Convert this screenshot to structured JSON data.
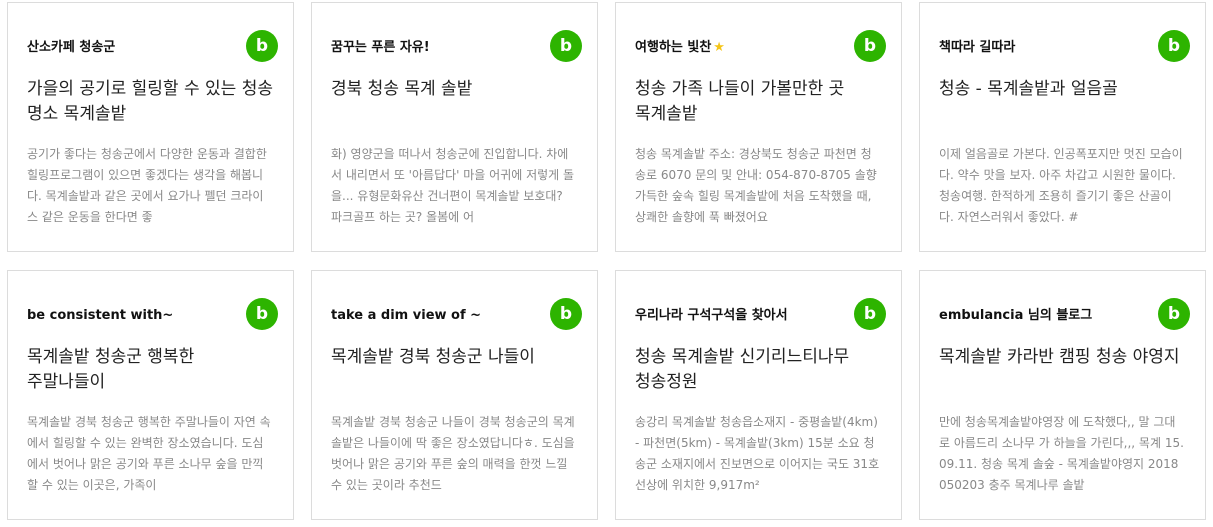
{
  "colors": {
    "brand_green": "#2db400",
    "border": "#dcdcdc",
    "title_text": "#222222",
    "snippet_text": "#888888",
    "star": "#f5c518"
  },
  "icons": {
    "blog_badge": "b",
    "star": "★"
  },
  "cards": [
    {
      "blog_name": "산소카페 청송군",
      "title": "가을의 공기로 힐링할 수 있는 청송 명소 목계솔밭",
      "snippet": "공기가 좋다는 청송군에서 다양한 운동과 결합한 힐링프로그램이 있으면 좋겠다는 생각을 해봅니다. 목계솔밭과 같은 곳에서 요가나 펠던 크라이스 같은 운동을 한다면 좋"
    },
    {
      "blog_name": "꿈꾸는 푸른 자유!",
      "title": "경북 청송 목계 솔밭",
      "snippet": "화) 영양군을 떠나서 청송군에 진입합니다. 차에서 내리면서 또 '아름답다' 마을 어귀에 저렇게 돌을... 유형문화유산 건너편이 목계솔밭 보호대? 파크골프 하는 곳? 올봄에 어"
    },
    {
      "blog_name": "여행하는 빛찬",
      "has_star": true,
      "title": "청송 가족 나들이 가볼만한 곳 목계솔밭",
      "snippet": "청송 목계솔밭 주소: 경상북도 청송군 파천면 청송로 6070 문의 및 안내: 054-870-8705 솔향 가득한 숲속 힐링 목계솔밭에 처음 도착했을 때, 상쾌한 솔향에 푹 빠졌어요"
    },
    {
      "blog_name": "책따라 길따라",
      "title": "청송 - 목계솔밭과 얼음골",
      "snippet": "이제 얼음골로 가본다. 인공폭포지만 멋진 모습이다. 약수 맛을 보자. 아주 차갑고 시원한 물이다. 청송여행. 한적하게 조용히 즐기기 좋은 산골이다. 자연스러워서 좋았다. #"
    },
    {
      "blog_name": "be consistent with~",
      "title": "목계솔밭 청송군 행복한 주말나들이",
      "snippet": "목계솔밭 경북 청송군 행복한 주말나들이 자연 속에서 힐링할 수 있는 완벽한 장소였습니다. 도심에서 벗어나 맑은 공기와 푸른 소나무 숲을 만끽할 수 있는 이곳은, 가족이"
    },
    {
      "blog_name": "take a dim view of ~",
      "title": "목계솔밭 경북 청송군 나들이",
      "snippet": "목계솔밭 경북 청송군 나들이 경북 청송군의 목계솔밭은 나들이에 딱 좋은 장소였답니다ㅎ. 도심을 벗어나 맑은 공기와 푸른 숲의 매력을 한껏 느낄 수 있는 곳이라 추천드"
    },
    {
      "blog_name": "우리나라 구석구석을 찾아서",
      "title": "청송 목계솔밭 신기리느티나무 청송정원",
      "snippet": "송강리 목계솔밭 청송읍소재지 - 중평솔밭(4km) - 파천면(5km) - 목계솔밭(3km) 15분 소요 청송군 소재지에서 진보면으로 이어지는 국도 31호 선상에 위치한 9,917m²"
    },
    {
      "blog_name": "embulancia 님의 블로그",
      "title": "목계솔밭 카라반 캠핑 청송 야영지",
      "snippet": "만에 청송목계솔밭야영장 에 도착했다,, 말 그대로 아름드리 소나무 가 하늘을 가린다,,, 목계 15.09.11. 청송 목계 솔숲 - 목계솔밭야영지 2018050203 충주 목계나루 솔밭"
    }
  ]
}
